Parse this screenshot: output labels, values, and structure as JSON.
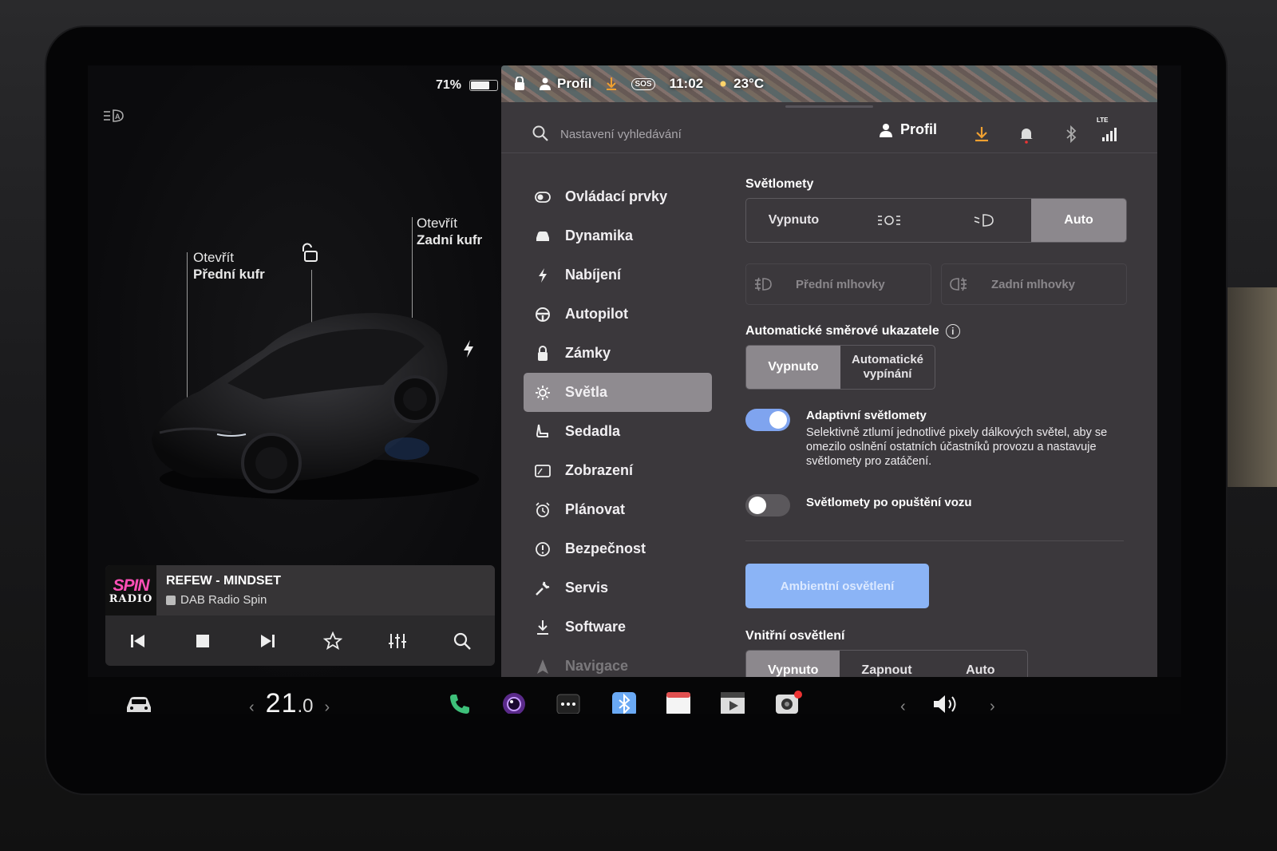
{
  "vehicle": {
    "battery_percent_text": "71%",
    "battery_level": 0.71,
    "front_trunk": {
      "line1": "Otevřít",
      "line2": "Přední kufr"
    },
    "rear_trunk": {
      "line1": "Otevřít",
      "line2": "Zadní kufr"
    }
  },
  "media": {
    "station_logo_line1": "SPIN",
    "station_logo_line2": "RADIO",
    "track_title": "REFEW - MINDSET",
    "station_name": "DAB Radio Spin",
    "controls": [
      "previous",
      "stop",
      "next",
      "favorite",
      "equalizer",
      "search"
    ]
  },
  "status_bar": {
    "profile": "Profil",
    "time": "11:02",
    "sos": "SOS",
    "temperature": "23°C"
  },
  "top_bar": {
    "search_placeholder": "Nastavení vyhledávání",
    "profile_label": "Profil",
    "lte_label": "LTE"
  },
  "menu": {
    "items": [
      {
        "label": "Ovládací prvky",
        "icon": "toggle-icon"
      },
      {
        "label": "Dynamika",
        "icon": "car-icon"
      },
      {
        "label": "Nabíjení",
        "icon": "bolt-icon"
      },
      {
        "label": "Autopilot",
        "icon": "steering-wheel-icon"
      },
      {
        "label": "Zámky",
        "icon": "lock-icon"
      },
      {
        "label": "Světla",
        "icon": "sun-icon",
        "active": true
      },
      {
        "label": "Sedadla",
        "icon": "seat-icon"
      },
      {
        "label": "Zobrazení",
        "icon": "display-icon"
      },
      {
        "label": "Plánovat",
        "icon": "alarm-clock-icon"
      },
      {
        "label": "Bezpečnost",
        "icon": "alert-circle-icon"
      },
      {
        "label": "Servis",
        "icon": "wrench-icon"
      },
      {
        "label": "Software",
        "icon": "download-icon"
      },
      {
        "label": "Navigace",
        "icon": "navigation-icon"
      }
    ]
  },
  "lights": {
    "headlights_title": "Světlomety",
    "headlight_options": {
      "off": "Vypnuto",
      "auto": "Auto",
      "selected": "Auto"
    },
    "fog_front": "Přední mlhovky",
    "fog_rear": "Zadní mlhovky",
    "turn_signals_title": "Automatické směrové ukazatele",
    "turn_signal_options": {
      "off": "Vypnuto",
      "auto_line1": "Automatické",
      "auto_line2": "vypínání",
      "selected": "Vypnuto"
    },
    "adaptive_title": "Adaptivní světlomety",
    "adaptive_desc": "Selektivně ztlumí jednotlivé pixely dálkových světel, aby se omezilo oslnění ostatních účastníků provozu a nastavuje světlomety pro zatáčení.",
    "adaptive_enabled": true,
    "after_exit_title": "Světlomety po opuštění vozu",
    "after_exit_enabled": false,
    "ambient_button": "Ambientní osvětlení",
    "interior_title": "Vnitřní osvětlení",
    "interior_options": {
      "off": "Vypnuto",
      "on": "Zapnout",
      "auto": "Auto",
      "selected": "Vypnuto"
    }
  },
  "bottom_bar": {
    "cabin_temp_whole": "21",
    "cabin_temp_decimal": ".0"
  },
  "colors": {
    "toggle_on": "#7fa4ef",
    "ambient_button": "#8bb4f6",
    "panel_bg": "#3b383c",
    "selected_segment": "#8c888d",
    "download_accent": "#f0a030",
    "notification_dot": "#e33"
  }
}
